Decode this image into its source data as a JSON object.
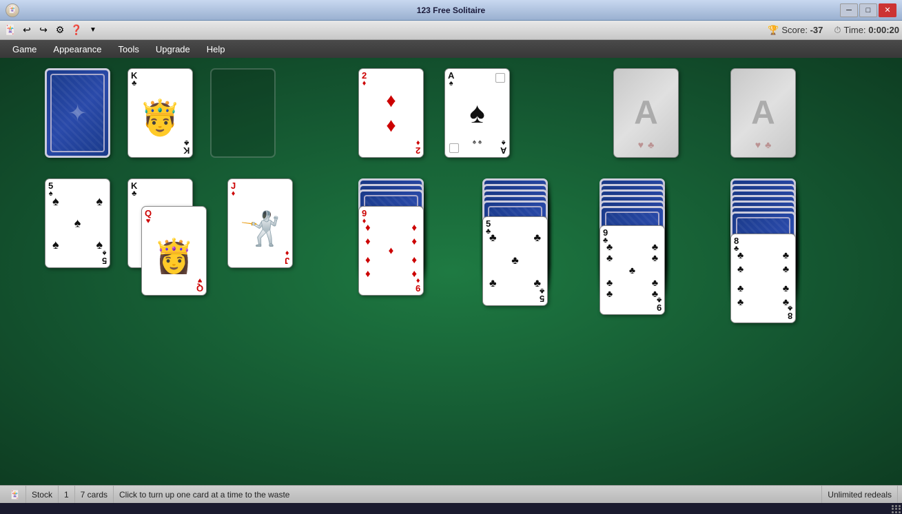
{
  "window": {
    "title": "123 Free Solitaire",
    "min_label": "─",
    "max_label": "□",
    "close_label": "✕"
  },
  "toolbar": {
    "icons": [
      "🃏",
      "↩",
      "↪",
      "⚙",
      "❓",
      "▼"
    ]
  },
  "menu": {
    "items": [
      "Game",
      "Appearance",
      "Tools",
      "Upgrade",
      "Help"
    ]
  },
  "score": {
    "label": "Score:",
    "value": "-37",
    "time_label": "Time:",
    "time_value": "0:00:20"
  },
  "status": {
    "stock_label": "Stock",
    "stock_count": "1",
    "cards_label": "7 cards",
    "hint": "Click to turn up one card at a time to the waste",
    "redeals": "Unlimited redeals"
  }
}
